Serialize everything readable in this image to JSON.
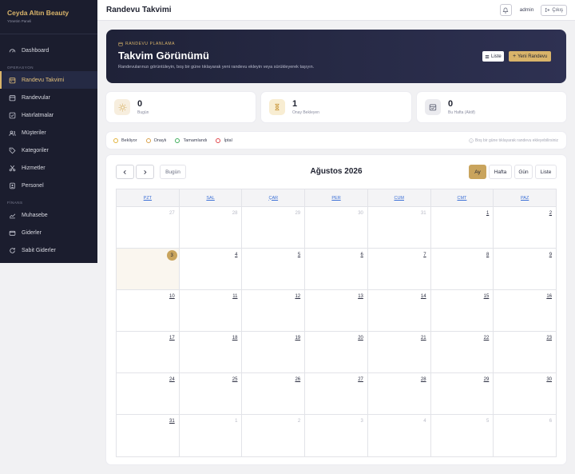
{
  "brand": {
    "name": "Ceyda Altın Beauty",
    "subtitle": "Yönetim Paneli"
  },
  "sidebar": {
    "items": [
      {
        "label": "Dashboard",
        "icon": "gauge-icon"
      },
      {
        "section": "OPERASYON"
      },
      {
        "label": "Randevu Takvimi",
        "icon": "calendar-icon",
        "active": true
      },
      {
        "label": "Randevular",
        "icon": "calendar-list-icon"
      },
      {
        "label": "Hatırlatmalar",
        "icon": "checklist-icon"
      },
      {
        "label": "Müşteriler",
        "icon": "users-icon"
      },
      {
        "label": "Kategoriler",
        "icon": "tag-icon"
      },
      {
        "label": "Hizmetler",
        "icon": "scissors-icon"
      },
      {
        "label": "Personel",
        "icon": "id-card-icon"
      },
      {
        "section": "FİNANS"
      },
      {
        "label": "Muhasebe",
        "icon": "chart-line-icon"
      },
      {
        "label": "Giderler",
        "icon": "wallet-icon"
      },
      {
        "label": "Sabit Giderler",
        "icon": "refresh-icon"
      }
    ]
  },
  "topbar": {
    "title": "Randevu Takvimi",
    "user": "admin",
    "logout_label": "Çıkış"
  },
  "hero": {
    "eyebrow": "RANDEVU PLANLAMA",
    "title": "Takvim Görünümü",
    "description": "Randevularınızı görüntüleyin, boş bir güne tıklayarak yeni randevu ekleyin veya sürükleyerek taşıyın.",
    "list_button": "Liste",
    "new_button": "Yeni Randevu"
  },
  "stats": [
    {
      "value": "0",
      "label": "Bugün",
      "icon": "sun-icon",
      "color": "#f7eede",
      "iconColor": "#d9b46a"
    },
    {
      "value": "1",
      "label": "Onay Bekleyen",
      "icon": "hourglass-icon",
      "color": "#f8edd2",
      "iconColor": "#c9963a"
    },
    {
      "value": "0",
      "label": "Bu Hafta (Aktif)",
      "icon": "calendar-week-icon",
      "color": "#ebebef",
      "iconColor": "#5b5f72"
    }
  ],
  "legend": {
    "items": [
      {
        "label": "Bekliyor",
        "color": "#e2b33b"
      },
      {
        "label": "Onaylı",
        "color": "#d9a14a"
      },
      {
        "label": "Tamamlandı",
        "color": "#3fae5b"
      },
      {
        "label": "İptal",
        "color": "#e0474c"
      }
    ],
    "hint": "Boş bir güne tıklayarak randevu ekleyebilirsiniz"
  },
  "calendar": {
    "today_label": "Bugün",
    "month_title": "Ağustos 2026",
    "views": [
      {
        "label": "Ay",
        "active": true
      },
      {
        "label": "Hafta",
        "active": false
      },
      {
        "label": "Gün",
        "active": false
      },
      {
        "label": "Liste",
        "active": false
      }
    ],
    "weekdays": [
      "PZT",
      "SAL",
      "ÇAR",
      "PER",
      "CUM",
      "CMT",
      "PAZ"
    ],
    "weeks": [
      [
        {
          "d": "27",
          "o": true
        },
        {
          "d": "28",
          "o": true
        },
        {
          "d": "29",
          "o": true
        },
        {
          "d": "30",
          "o": true
        },
        {
          "d": "31",
          "o": true
        },
        {
          "d": "1"
        },
        {
          "d": "2"
        }
      ],
      [
        {
          "d": "3",
          "t": true
        },
        {
          "d": "4"
        },
        {
          "d": "5"
        },
        {
          "d": "6"
        },
        {
          "d": "7"
        },
        {
          "d": "8"
        },
        {
          "d": "9"
        }
      ],
      [
        {
          "d": "10"
        },
        {
          "d": "11"
        },
        {
          "d": "12"
        },
        {
          "d": "13"
        },
        {
          "d": "14"
        },
        {
          "d": "15"
        },
        {
          "d": "16"
        }
      ],
      [
        {
          "d": "17"
        },
        {
          "d": "18"
        },
        {
          "d": "19"
        },
        {
          "d": "20"
        },
        {
          "d": "21"
        },
        {
          "d": "22"
        },
        {
          "d": "23"
        }
      ],
      [
        {
          "d": "24"
        },
        {
          "d": "25"
        },
        {
          "d": "26"
        },
        {
          "d": "27"
        },
        {
          "d": "28"
        },
        {
          "d": "29"
        },
        {
          "d": "30"
        }
      ],
      [
        {
          "d": "31"
        },
        {
          "d": "1",
          "o": true
        },
        {
          "d": "2",
          "o": true
        },
        {
          "d": "3",
          "o": true
        },
        {
          "d": "4",
          "o": true
        },
        {
          "d": "5",
          "o": true
        },
        {
          "d": "6",
          "o": true
        }
      ]
    ]
  }
}
